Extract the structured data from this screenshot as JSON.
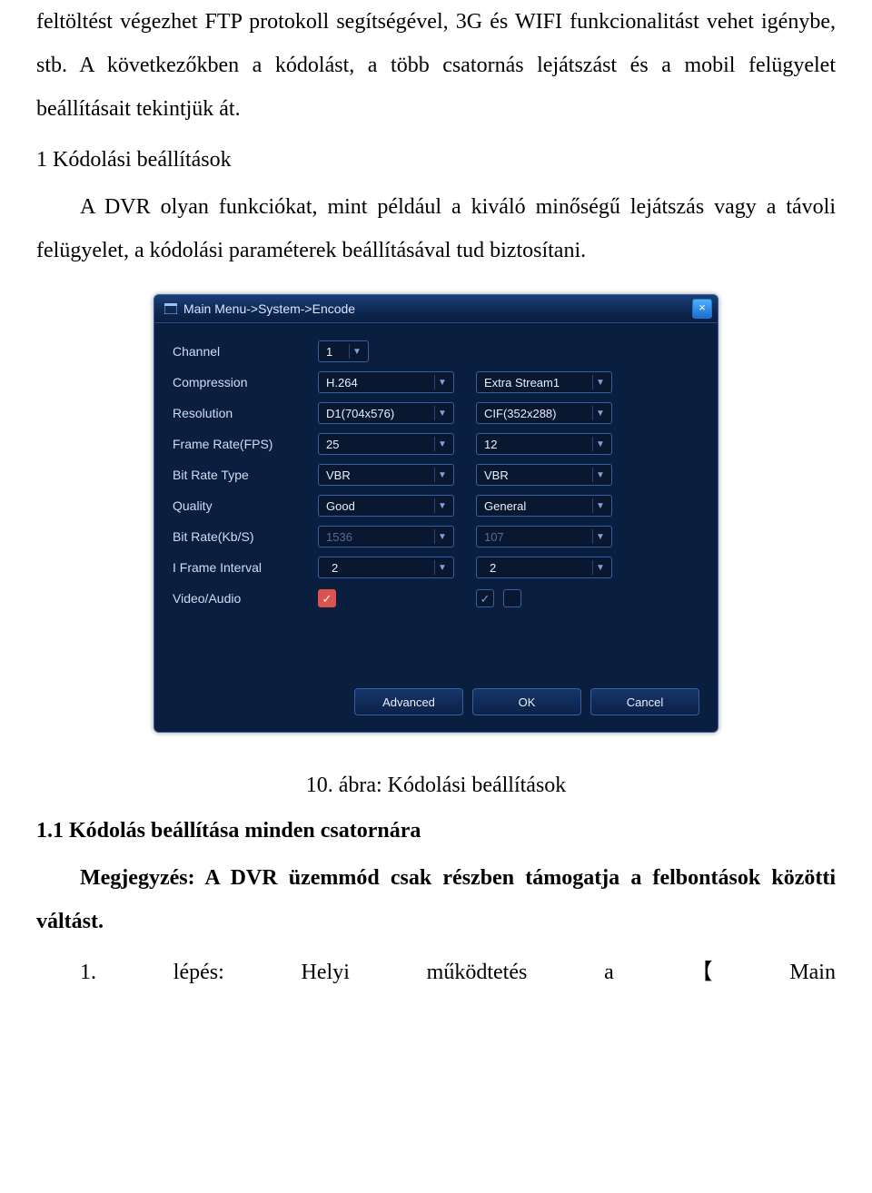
{
  "text": {
    "p1": "feltöltést végezhet FTP protokoll segítségével, 3G és WIFI funkcionalitást vehet igénybe, stb. A következőkben a kódolást, a több csatornás lejátszást és a mobil felügyelet beállításait tekintjük át.",
    "h1": "1 Kódolási beállítások",
    "p2": "A DVR olyan funkciókat, mint például a kiváló minőségű lejátszás vagy a távoli felügyelet, a kódolási paraméterek beállításával tud biztosítani.",
    "caption": "10. ábra: Kódolási beállítások",
    "h2": "1.1 Kódolás beállítása minden csatornára",
    "p3": "Megjegyzés: A DVR üzemmód csak részben támogatja a felbontások közötti váltást.",
    "p4a": "1.",
    "p4b": "lépés:",
    "p4c": "Helyi",
    "p4d": "működtetés",
    "p4e": "a",
    "p4f": "【",
    "p4g": "Main"
  },
  "window": {
    "title": "Main Menu->System->Encode",
    "close": "×",
    "labels": {
      "channel": "Channel",
      "compression": "Compression",
      "resolution": "Resolution",
      "fps": "Frame Rate(FPS)",
      "brtype": "Bit Rate Type",
      "quality": "Quality",
      "brkbs": "Bit Rate(Kb/S)",
      "iframe": "I Frame Interval",
      "va": "Video/Audio"
    },
    "main": {
      "channel": "1",
      "compression": "H.264",
      "resolution": "D1(704x576)",
      "fps": "25",
      "brtype": "VBR",
      "quality": "Good",
      "brkbs": "1536",
      "iframe": "2"
    },
    "sub": {
      "compression": "Extra Stream1",
      "resolution": "CIF(352x288)",
      "fps": "12",
      "brtype": "VBR",
      "quality": "General",
      "brkbs": "107",
      "iframe": "2"
    },
    "buttons": {
      "advanced": "Advanced",
      "ok": "OK",
      "cancel": "Cancel"
    }
  }
}
